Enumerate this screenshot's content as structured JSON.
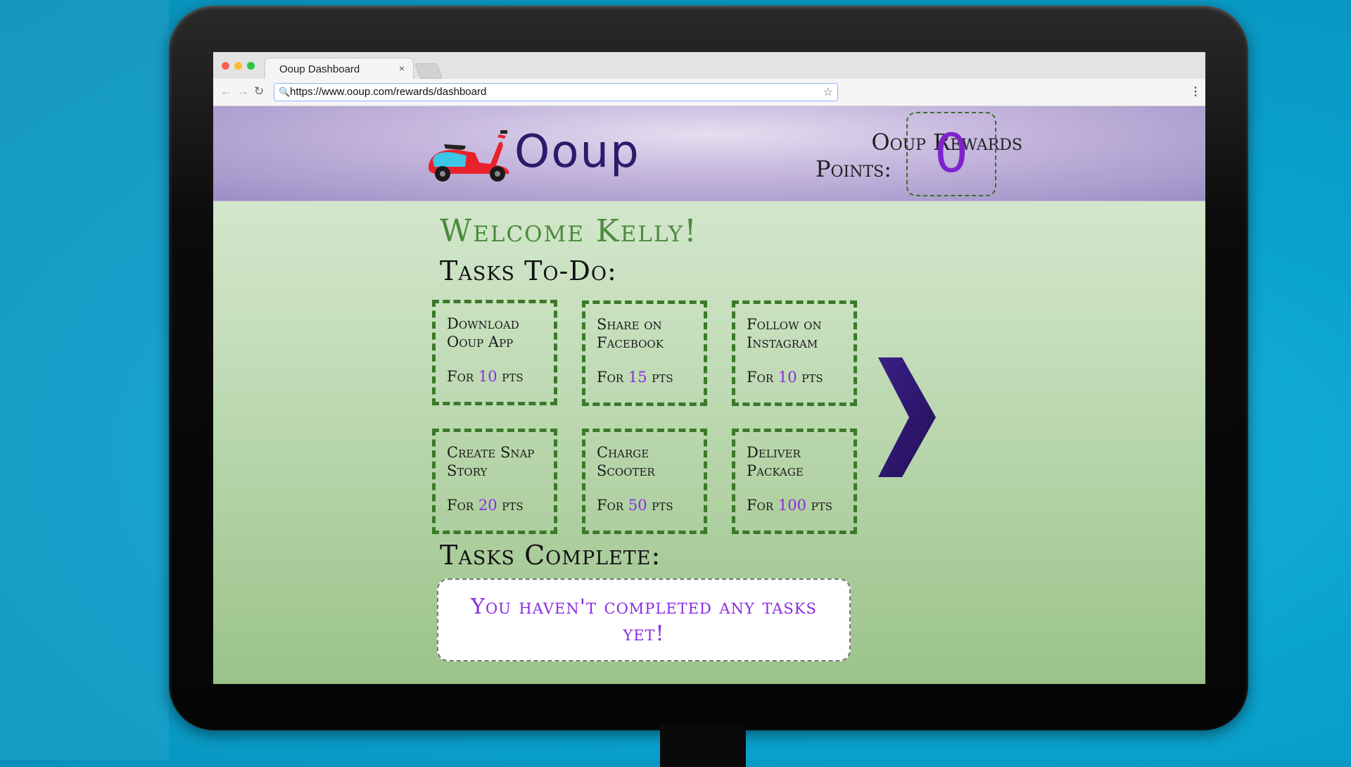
{
  "browser": {
    "tab_title": "Ooup Dashboard",
    "tab_close": "×",
    "url": "https://www.ooup.com/rewards/dashboard",
    "back_icon": "arrow-left-icon",
    "forward_icon": "arrow-right-icon",
    "reload_icon": "reload-icon",
    "star_icon": "star-icon",
    "menu_icon": "kebab-menu-icon"
  },
  "header": {
    "brand": "Ooup",
    "rewards_label_line1": "Ooup Rewards",
    "rewards_label_line2": "Points:",
    "points": "0",
    "logo_icon": "scooter-icon"
  },
  "main": {
    "welcome": "Welcome Kelly!",
    "todo_title": "Tasks To-Do:",
    "tasks": [
      {
        "name": "Download Ooup App",
        "prefix": "For",
        "points": "10",
        "suffix": "pts"
      },
      {
        "name": "Share on Facebook",
        "prefix": "For",
        "points": "15",
        "suffix": "pts"
      },
      {
        "name": "Follow on Instagram",
        "prefix": "For",
        "points": "10",
        "suffix": "pts"
      },
      {
        "name": "Create Snap Story",
        "prefix": "For",
        "points": "20",
        "suffix": "pts"
      },
      {
        "name": "Charge Scooter",
        "prefix": "For",
        "points": "50",
        "suffix": "pts"
      },
      {
        "name": "Deliver Package",
        "prefix": "For",
        "points": "100",
        "suffix": "pts"
      }
    ],
    "next_icon": "chevron-right-icon",
    "complete_title": "Tasks Complete:",
    "complete_message": "You haven't completed any tasks yet!"
  },
  "colors": {
    "accent_purple": "#8a2be2",
    "brand_navy": "#2c1a6a",
    "dash_green": "#3b7a28",
    "welcome_green": "#4a8a3c"
  }
}
